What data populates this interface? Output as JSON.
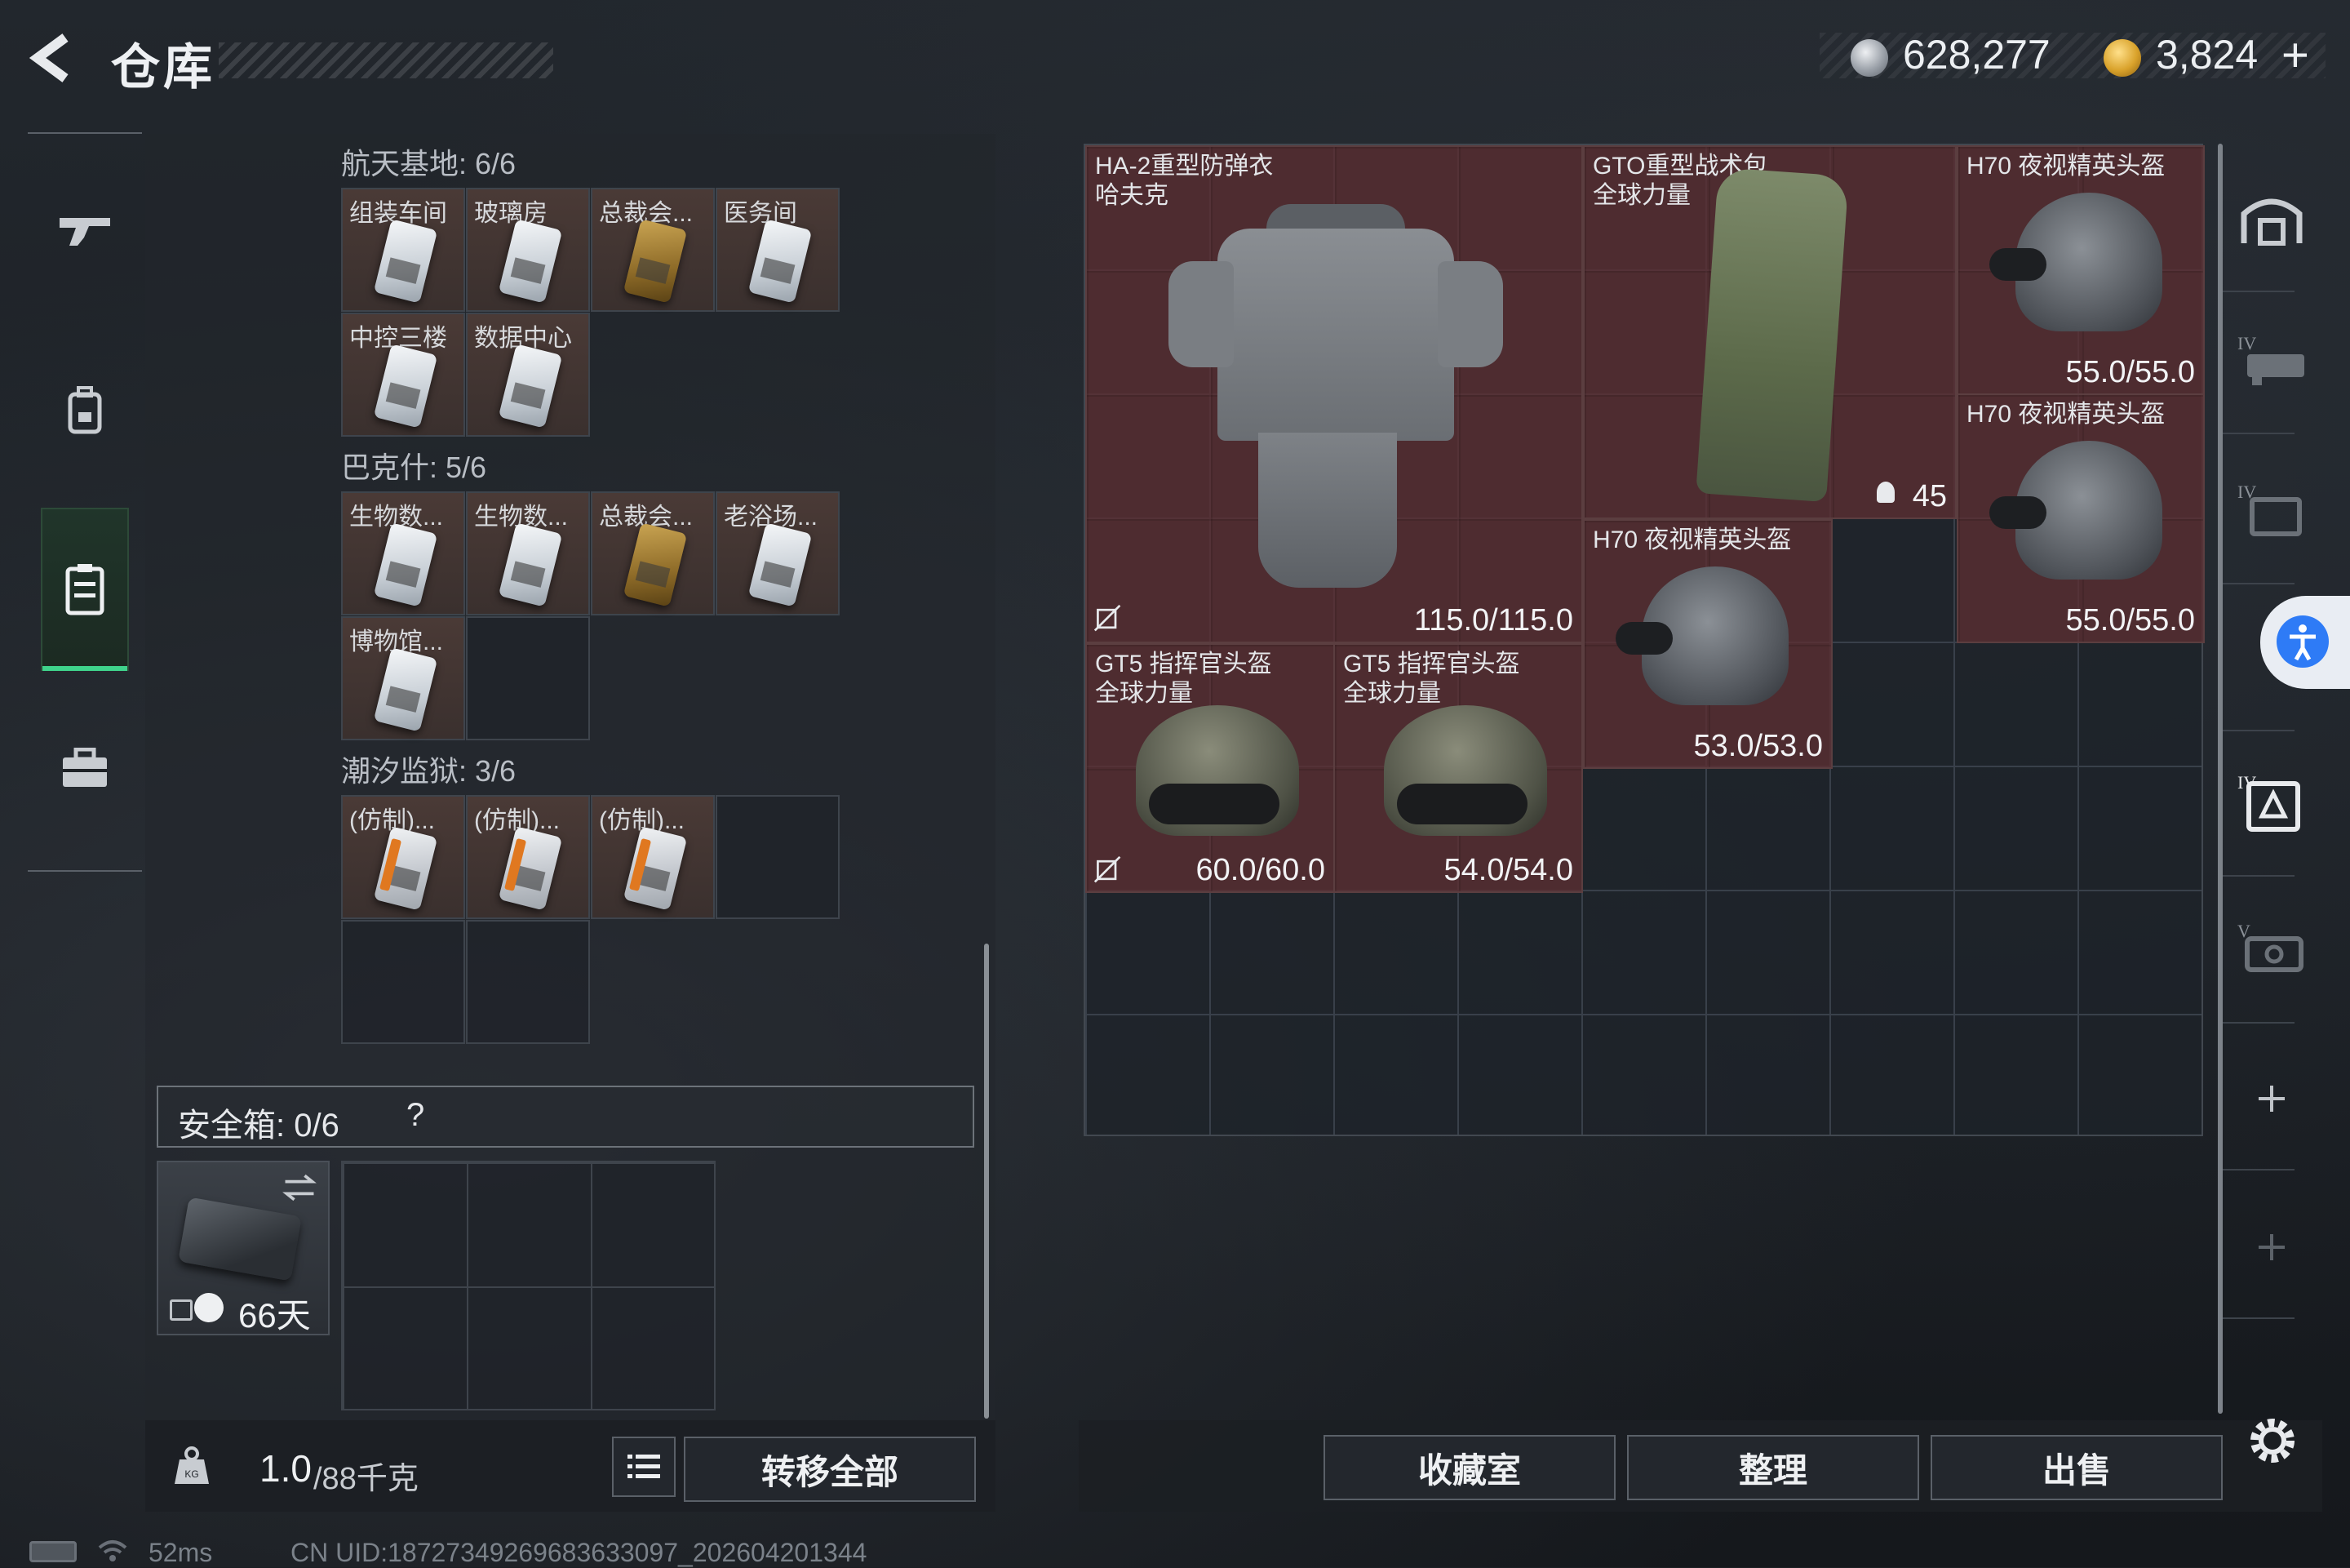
{
  "header": {
    "title": "仓库"
  },
  "currency": {
    "silver": "628,277",
    "gold": "3,824",
    "plus": "+",
    "silver_color": "#c9ccd1",
    "gold_color": "#e3b53c"
  },
  "nav": {
    "items": [
      "weapon-icon",
      "backpack-icon",
      "keycard-case-icon",
      "briefcase-icon"
    ],
    "active": 2
  },
  "sections": [
    {
      "label": "航天基地: 6/6",
      "slots": [
        {
          "label": "组装车间",
          "card": "white"
        },
        {
          "label": "玻璃房",
          "card": "white"
        },
        {
          "label": "总裁会...",
          "card": "gold"
        },
        {
          "label": "医务间",
          "card": "white"
        },
        {
          "label": "中控三楼",
          "card": "white"
        },
        {
          "label": "数据中心",
          "card": "white"
        }
      ]
    },
    {
      "label": "巴克什: 5/6",
      "slots": [
        {
          "label": "生物数...",
          "card": "white"
        },
        {
          "label": "生物数...",
          "card": "white"
        },
        {
          "label": "总裁会...",
          "card": "gold"
        },
        {
          "label": "老浴场...",
          "card": "white"
        },
        {
          "label": "博物馆...",
          "card": "white"
        }
      ]
    },
    {
      "label": "潮汐监狱: 3/6",
      "slots": [
        {
          "label": "(仿制)...",
          "card": "orange"
        },
        {
          "label": "(仿制)...",
          "card": "orange"
        },
        {
          "label": "(仿制)...",
          "card": "orange"
        }
      ]
    }
  ],
  "safebox": {
    "label": "安全箱: 0/6",
    "help": "?",
    "days": "66天"
  },
  "weight": {
    "value": "1.0",
    "max": "/88千克"
  },
  "buttons": {
    "transfer_all": "转移全部",
    "collection": "收藏室",
    "organize": "整理",
    "sell": "出售"
  },
  "items": [
    {
      "name": "HA-2重型防弹衣\n哈夫克",
      "durability": "115.0/115.0",
      "type": "armor"
    },
    {
      "name": "GTO重型战术包\n全球力量",
      "count": "45",
      "type": "backpack"
    },
    {
      "name": "H70 夜视精英头盔",
      "durability": "55.0/55.0",
      "type": "nvg"
    },
    {
      "name": "H70 夜视精英头盔",
      "durability": "55.0/55.0",
      "type": "nvg"
    },
    {
      "name": "H70 夜视精英头盔",
      "durability": "53.0/53.0",
      "type": "nvg"
    },
    {
      "name": "GT5 指挥官头盔\n全球力量",
      "durability": "60.0/60.0",
      "type": "helmet"
    },
    {
      "name": "GT5 指挥官头盔\n全球力量",
      "durability": "54.0/54.0",
      "type": "helmet"
    }
  ],
  "status": {
    "ping": "52ms",
    "uid": "CN UID:18727349269683633097_202604201344"
  }
}
